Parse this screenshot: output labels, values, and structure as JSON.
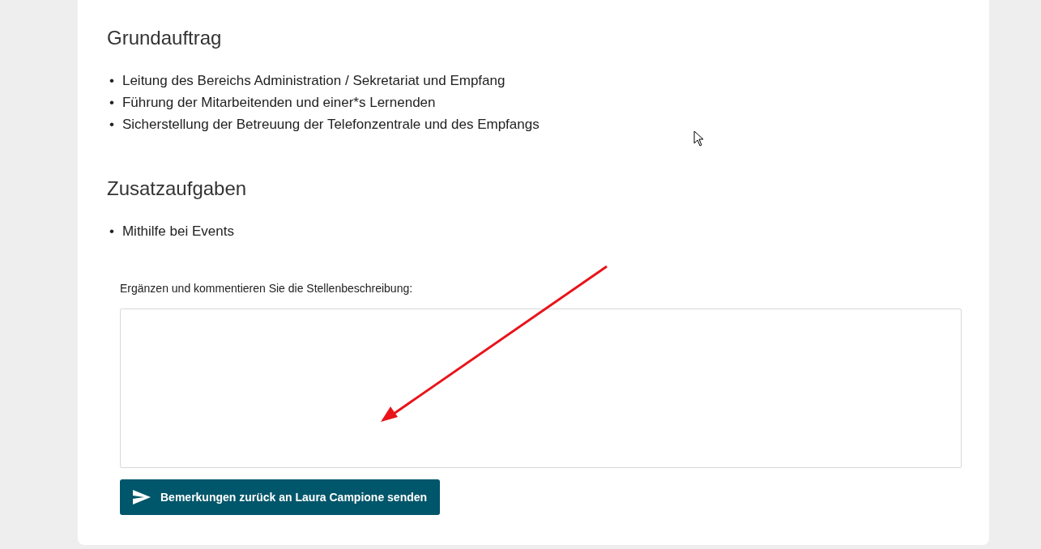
{
  "sections": [
    {
      "heading": "Grundauftrag",
      "items": [
        {
          "marker": "•",
          "text": "Leitung des Bereichs Administration / Sekretariat und Empfang"
        },
        {
          "marker": "•",
          "text": "Führung der Mitarbeitenden und einer*s Lernenden"
        },
        {
          "marker": "•",
          "text": "Sicherstellung der Betreuung der Telefonzentrale und des Empfangs"
        }
      ]
    },
    {
      "heading": "Zusatzaufgaben",
      "items": [
        {
          "marker": "•",
          "text": "Mithilfe bei Events"
        }
      ]
    }
  ],
  "comment": {
    "label": "Ergänzen und kommentieren Sie die Stellenbeschreibung:"
  },
  "send_button": {
    "label": "Bemerkungen zurück an Laura Campione senden"
  }
}
